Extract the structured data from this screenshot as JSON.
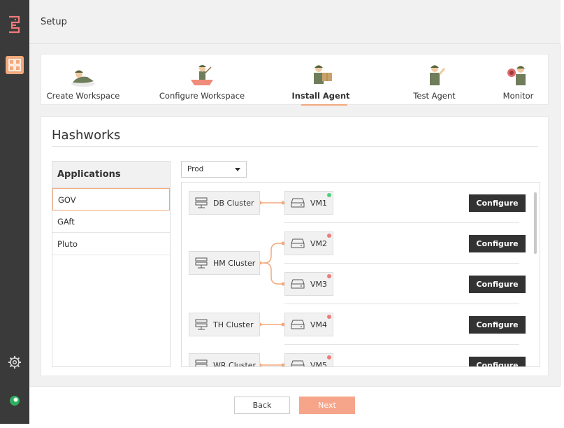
{
  "header": {
    "title": "Setup"
  },
  "stepper": {
    "steps": [
      {
        "label": "Create Workspace",
        "icon": "soldier-lying-icon"
      },
      {
        "label": "Configure Workspace",
        "icon": "soldier-boat-icon"
      },
      {
        "label": "Install Agent",
        "icon": "soldier-box-icon",
        "active": true
      },
      {
        "label": "Test Agent",
        "icon": "soldier-saluting-icon"
      },
      {
        "label": "Monitor",
        "icon": "soldier-binoculars-icon"
      }
    ]
  },
  "workspace": {
    "name": "Hashworks"
  },
  "applications": {
    "header": "Applications",
    "items": [
      "GOV",
      "GAft",
      "Pluto"
    ],
    "selected": "GOV"
  },
  "environment": {
    "selected": "Prod"
  },
  "topology": {
    "clusters": [
      {
        "name": "DB Cluster",
        "vms": [
          {
            "name": "VM1",
            "status": "online"
          }
        ]
      },
      {
        "name": "HM Cluster",
        "vms": [
          {
            "name": "VM2",
            "status": "offline"
          },
          {
            "name": "VM3",
            "status": "offline"
          }
        ]
      },
      {
        "name": "TH Cluster",
        "vms": [
          {
            "name": "VM4",
            "status": "offline"
          }
        ]
      },
      {
        "name": "WR Cluster",
        "vms": [
          {
            "name": "VM5",
            "status": "offline"
          }
        ]
      }
    ],
    "configure_label": "Configure"
  },
  "footer": {
    "back_label": "Back",
    "next_label": "Next"
  },
  "colors": {
    "accent": "#f2a97c",
    "online": "#4cd07d",
    "offline": "#f07a7a",
    "dark_button": "#333333",
    "rail": "#3a3a3a"
  }
}
